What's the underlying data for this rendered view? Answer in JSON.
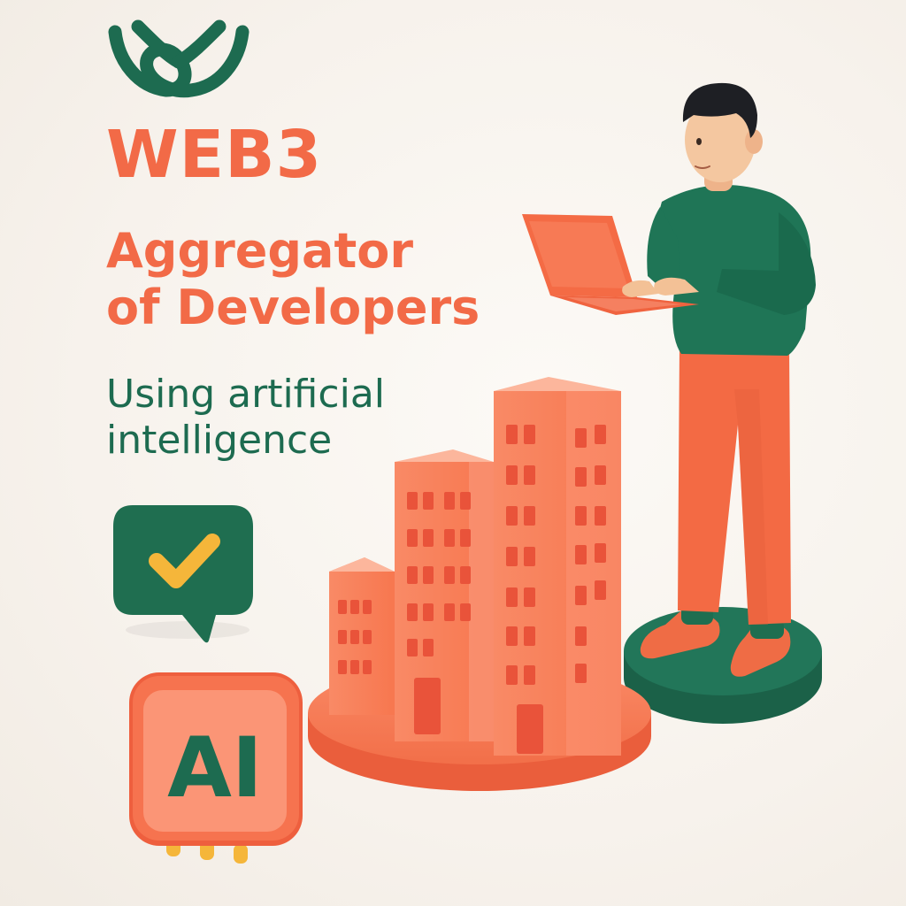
{
  "hero": {
    "title": "WEB3",
    "subtitle_line1": "Aggregator",
    "subtitle_line2": "of Developers",
    "tagline_line1": "Using artificial",
    "tagline_line2": "intelligence"
  },
  "ai_chip": {
    "label": "AI"
  },
  "colors": {
    "brand_green": "#1d6b50",
    "accent_orange": "#f26a47",
    "check_yellow": "#f5b63a",
    "background": "#f8f4ef"
  },
  "icons": {
    "logo": "brand-logo",
    "chat": "chat-bubble-check-icon",
    "chip": "ai-chip-icon"
  }
}
